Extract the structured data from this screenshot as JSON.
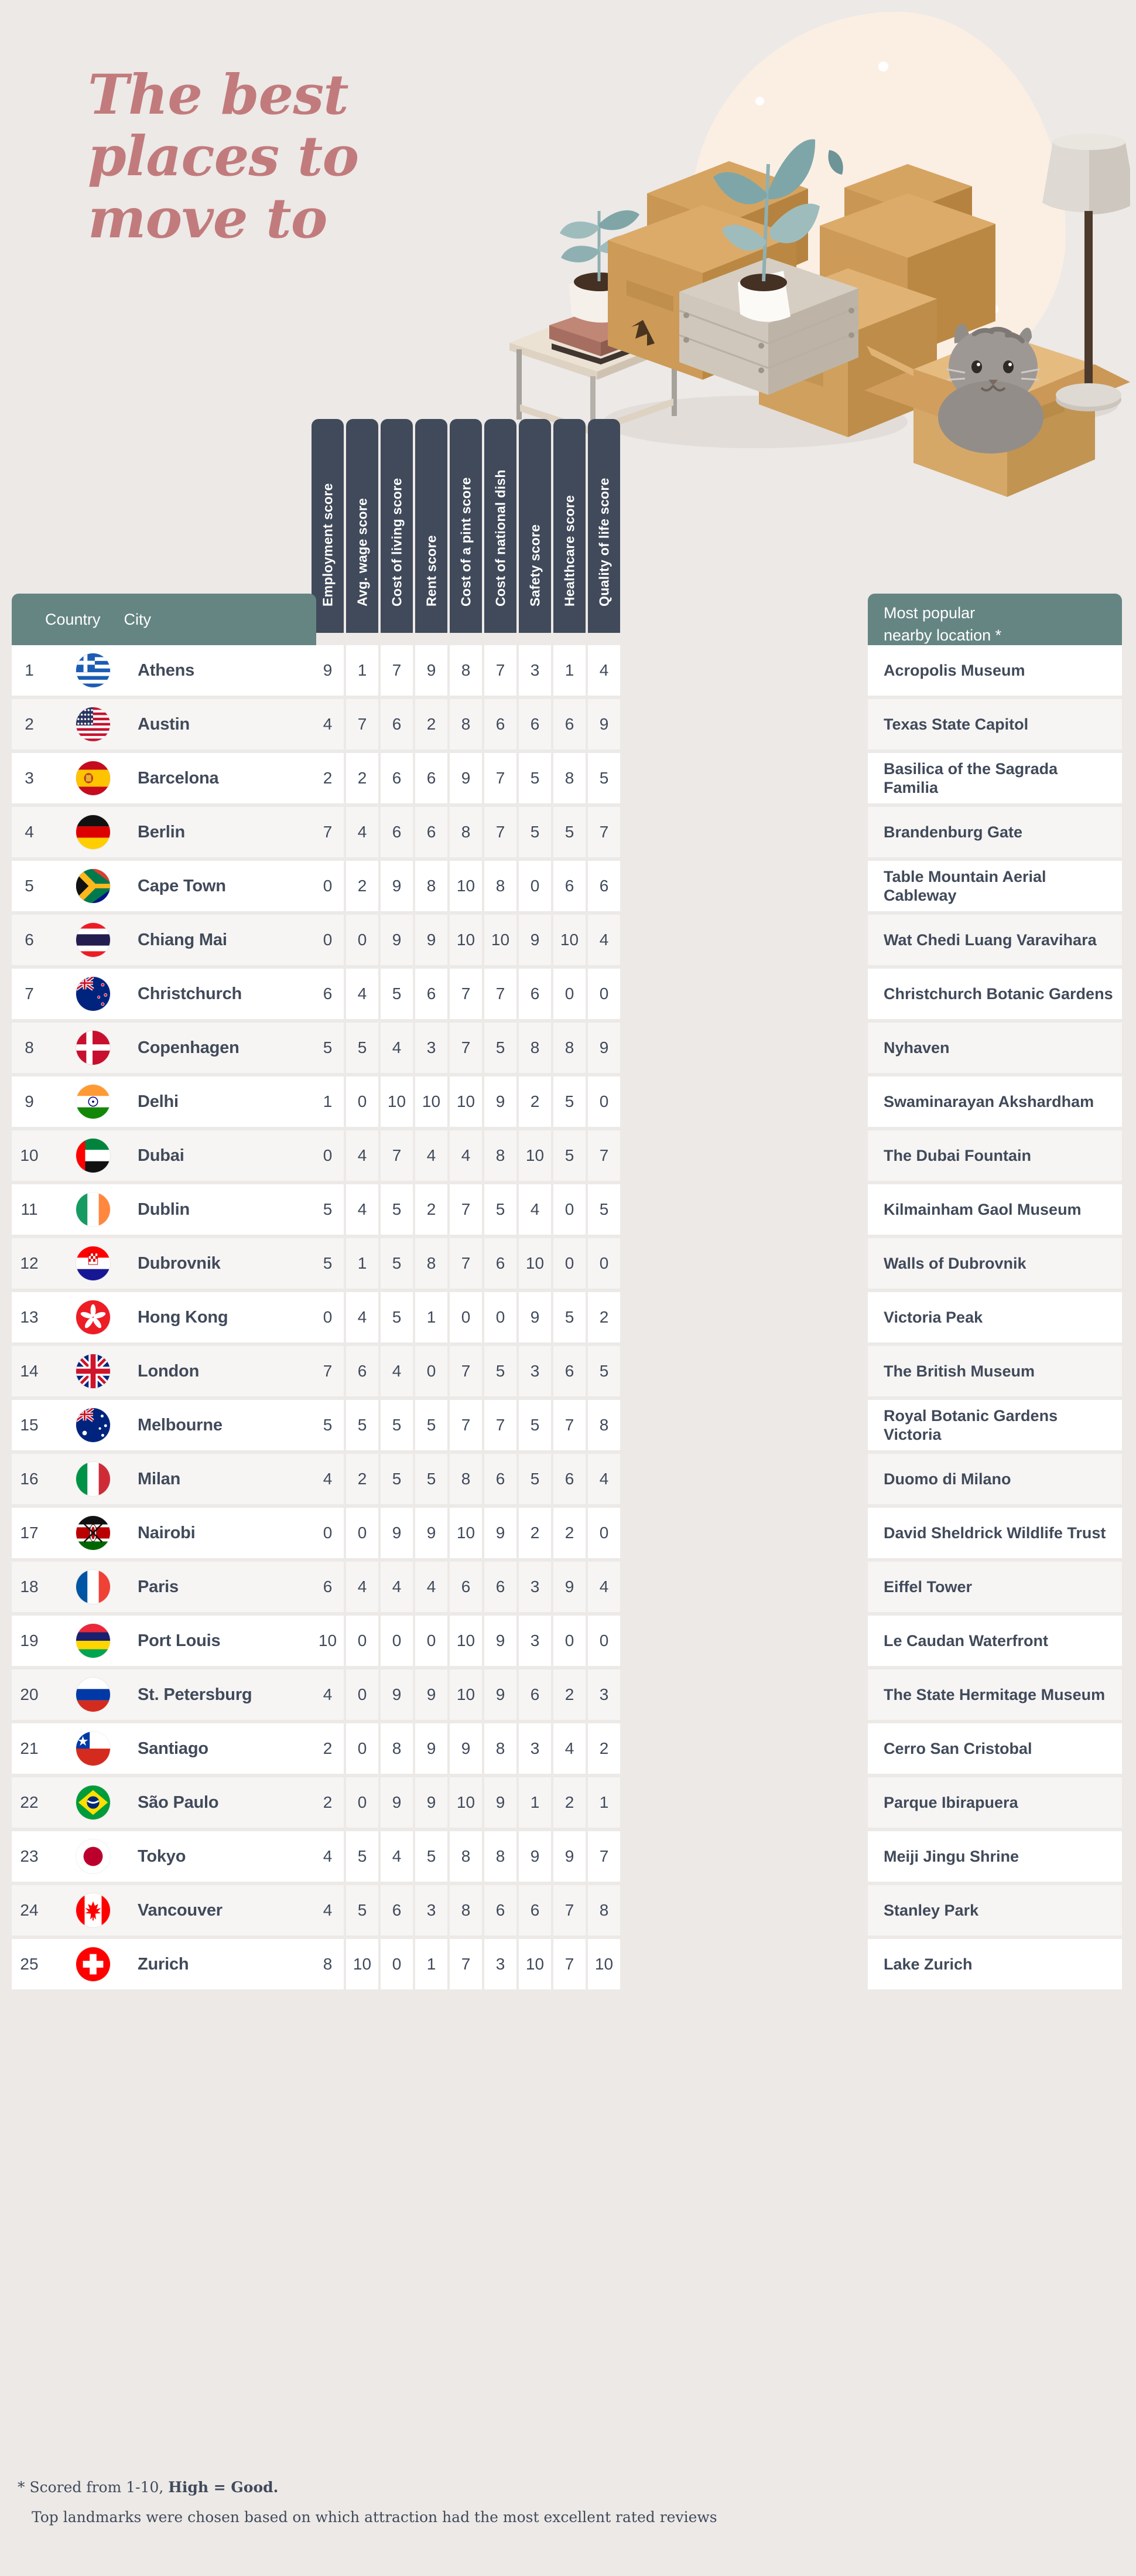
{
  "hero": {
    "title": "The best\nplaces to\nmove to",
    "title_color": "#c27b7c",
    "illustration": "moving-boxes-cat-illustration"
  },
  "theme": {
    "background": "#ece9e7",
    "green": "#658583",
    "navy": "#414a5a",
    "blob": "#fbefe4",
    "row_white": "#ffffff",
    "row_alt": "#f6f5f4"
  },
  "table": {
    "left_header": {
      "country": "Country",
      "city": "City"
    },
    "score_headers": [
      "Employment score",
      "Avg. wage score",
      "Cost of living score",
      "Rent score",
      "Cost of a pint score",
      "Cost of national dish",
      "Safety score",
      "Healthcare score",
      "Quality of life score"
    ],
    "right_header_line1": "Most popular",
    "right_header_line2": "nearby location  *",
    "rows": [
      {
        "rank": "1",
        "flag": "greece-flag",
        "city": "Athens",
        "scores": [
          "9",
          "1",
          "7",
          "9",
          "8",
          "7",
          "3",
          "1",
          "4"
        ],
        "place": "Acropolis Museum"
      },
      {
        "rank": "2",
        "flag": "usa-flag",
        "city": "Austin",
        "scores": [
          "4",
          "7",
          "6",
          "2",
          "8",
          "6",
          "6",
          "6",
          "9"
        ],
        "place": "Texas State Capitol"
      },
      {
        "rank": "3",
        "flag": "spain-flag",
        "city": "Barcelona",
        "scores": [
          "2",
          "2",
          "6",
          "6",
          "9",
          "7",
          "5",
          "8",
          "5"
        ],
        "place": "Basilica of the Sagrada Familia"
      },
      {
        "rank": "4",
        "flag": "germany-flag",
        "city": "Berlin",
        "scores": [
          "7",
          "4",
          "6",
          "6",
          "8",
          "7",
          "5",
          "5",
          "7"
        ],
        "place": "Brandenburg Gate"
      },
      {
        "rank": "5",
        "flag": "south-africa-flag",
        "city": "Cape Town",
        "scores": [
          "0",
          "2",
          "9",
          "8",
          "10",
          "8",
          "0",
          "6",
          "6"
        ],
        "place": "Table Mountain Aerial Cableway"
      },
      {
        "rank": "6",
        "flag": "thailand-flag",
        "city": "Chiang Mai",
        "scores": [
          "0",
          "0",
          "9",
          "9",
          "10",
          "10",
          "9",
          "10",
          "4"
        ],
        "place": "Wat Chedi Luang Varavihara"
      },
      {
        "rank": "7",
        "flag": "new-zealand-flag",
        "city": "Christchurch",
        "scores": [
          "6",
          "4",
          "5",
          "6",
          "7",
          "7",
          "6",
          "0",
          "0"
        ],
        "place": "Christchurch Botanic Gardens"
      },
      {
        "rank": "8",
        "flag": "denmark-flag",
        "city": "Copenhagen",
        "scores": [
          "5",
          "5",
          "4",
          "3",
          "7",
          "5",
          "8",
          "8",
          "9"
        ],
        "place": "Nyhaven"
      },
      {
        "rank": "9",
        "flag": "india-flag",
        "city": "Delhi",
        "scores": [
          "1",
          "0",
          "10",
          "10",
          "10",
          "9",
          "2",
          "5",
          "0"
        ],
        "place": "Swaminarayan Akshardham"
      },
      {
        "rank": "10",
        "flag": "uae-flag",
        "city": "Dubai",
        "scores": [
          "0",
          "4",
          "7",
          "4",
          "4",
          "8",
          "10",
          "5",
          "7"
        ],
        "place": "The Dubai Fountain"
      },
      {
        "rank": "11",
        "flag": "ireland-flag",
        "city": "Dublin",
        "scores": [
          "5",
          "4",
          "5",
          "2",
          "7",
          "5",
          "4",
          "0",
          "5"
        ],
        "place": "Kilmainham Gaol Museum"
      },
      {
        "rank": "12",
        "flag": "croatia-flag",
        "city": "Dubrovnik",
        "scores": [
          "5",
          "1",
          "5",
          "8",
          "7",
          "6",
          "10",
          "0",
          "0"
        ],
        "place": "Walls of Dubrovnik"
      },
      {
        "rank": "13",
        "flag": "hong-kong-flag",
        "city": "Hong Kong",
        "scores": [
          "0",
          "4",
          "5",
          "1",
          "0",
          "0",
          "9",
          "5",
          "2"
        ],
        "place": "Victoria Peak"
      },
      {
        "rank": "14",
        "flag": "uk-flag",
        "city": "London",
        "scores": [
          "7",
          "6",
          "4",
          "0",
          "7",
          "5",
          "3",
          "6",
          "5"
        ],
        "place": "The British Museum"
      },
      {
        "rank": "15",
        "flag": "australia-flag",
        "city": "Melbourne",
        "scores": [
          "5",
          "5",
          "5",
          "5",
          "7",
          "7",
          "5",
          "7",
          "8"
        ],
        "place": "Royal Botanic Gardens Victoria"
      },
      {
        "rank": "16",
        "flag": "italy-flag",
        "city": "Milan",
        "scores": [
          "4",
          "2",
          "5",
          "5",
          "8",
          "6",
          "5",
          "6",
          "4"
        ],
        "place": "Duomo di Milano"
      },
      {
        "rank": "17",
        "flag": "kenya-flag",
        "city": "Nairobi",
        "scores": [
          "0",
          "0",
          "9",
          "9",
          "10",
          "9",
          "2",
          "2",
          "0"
        ],
        "place": "David Sheldrick Wildlife Trust"
      },
      {
        "rank": "18",
        "flag": "france-flag",
        "city": "Paris",
        "scores": [
          "6",
          "4",
          "4",
          "4",
          "6",
          "6",
          "3",
          "9",
          "4"
        ],
        "place": "Eiffel Tower"
      },
      {
        "rank": "19",
        "flag": "mauritius-flag",
        "city": "Port Louis",
        "scores": [
          "10",
          "0",
          "0",
          "0",
          "10",
          "9",
          "3",
          "0",
          "0"
        ],
        "place": "Le Caudan Waterfront"
      },
      {
        "rank": "20",
        "flag": "russia-flag",
        "city": "St. Petersburg",
        "scores": [
          "4",
          "0",
          "9",
          "9",
          "10",
          "9",
          "6",
          "2",
          "3"
        ],
        "place": "The State Hermitage Museum"
      },
      {
        "rank": "21",
        "flag": "chile-flag",
        "city": "Santiago",
        "scores": [
          "2",
          "0",
          "8",
          "9",
          "9",
          "8",
          "3",
          "4",
          "2"
        ],
        "place": "Cerro San Cristobal"
      },
      {
        "rank": "22",
        "flag": "brazil-flag",
        "city": "São Paulo",
        "scores": [
          "2",
          "0",
          "9",
          "9",
          "10",
          "9",
          "1",
          "2",
          "1"
        ],
        "place": "Parque Ibirapuera"
      },
      {
        "rank": "23",
        "flag": "japan-flag",
        "city": "Tokyo",
        "scores": [
          "4",
          "5",
          "4",
          "5",
          "8",
          "8",
          "9",
          "9",
          "7"
        ],
        "place": "Meiji Jingu Shrine"
      },
      {
        "rank": "24",
        "flag": "canada-flag",
        "city": "Vancouver",
        "scores": [
          "4",
          "5",
          "6",
          "3",
          "8",
          "6",
          "6",
          "7",
          "8"
        ],
        "place": "Stanley Park"
      },
      {
        "rank": "25",
        "flag": "switzerland-flag",
        "city": "Zurich",
        "scores": [
          "8",
          "10",
          "0",
          "1",
          "7",
          "3",
          "10",
          "7",
          "10"
        ],
        "place": "Lake Zurich"
      }
    ]
  },
  "footer": {
    "line1_prefix": "* Scored from 1-10, ",
    "line1_bold": "High = Good.",
    "line2": "Top landmarks were chosen based on which attraction had the most excellent rated reviews"
  }
}
